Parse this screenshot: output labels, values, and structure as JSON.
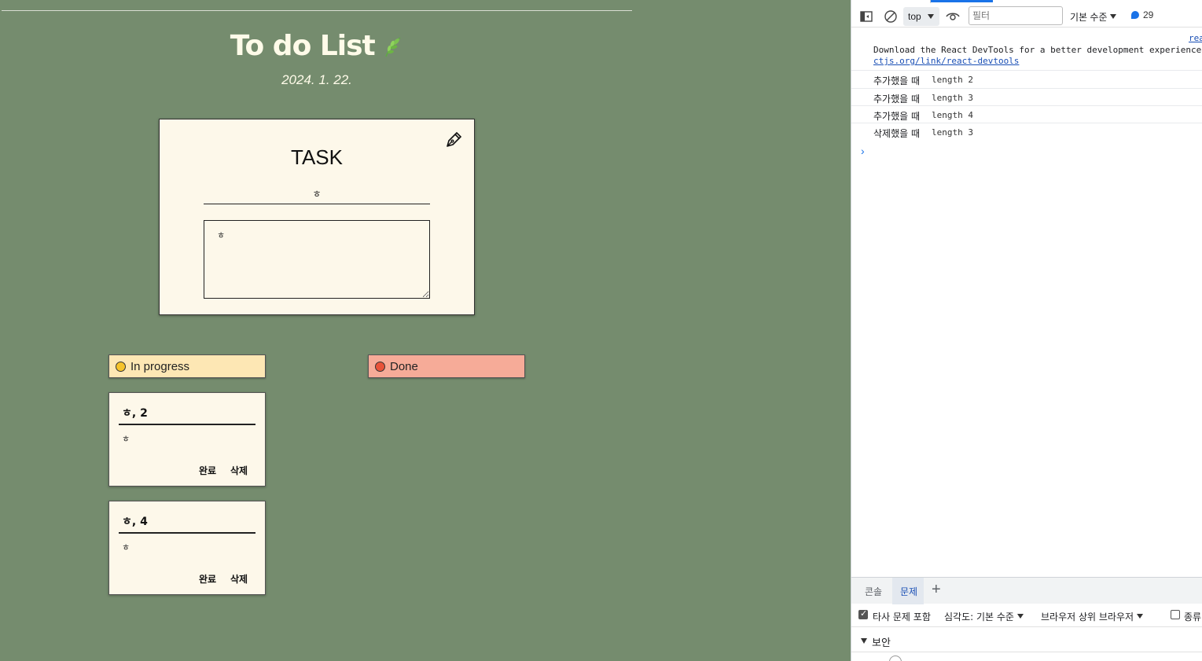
{
  "app": {
    "title": "To do List",
    "date": "2024. 1. 22.",
    "task_form": {
      "heading": "TASK",
      "title_value": "ㅎ",
      "content_value": "ㅎ"
    },
    "status": {
      "in_progress": "In progress",
      "done": "Done"
    },
    "todos": [
      {
        "title": "ㅎ, 2",
        "body": "ㅎ",
        "complete_label": "완료",
        "delete_label": "삭제"
      },
      {
        "title": "ㅎ, 4",
        "body": "ㅎ",
        "complete_label": "완료",
        "delete_label": "삭제"
      }
    ],
    "colors": {
      "background": "#758c6e",
      "card": "#fdf8ea",
      "in_progress": "#fde7b4",
      "done": "#f6ab98"
    }
  },
  "devtools": {
    "toolbar": {
      "context": "top",
      "filter_placeholder": "필터",
      "level": "기본 수준",
      "issues": "29"
    },
    "console": {
      "top_link": "rea",
      "devtools_message": "Download the React DevTools for a better development experience",
      "devtools_link": "ctjs.org/link/react-devtools",
      "logs": [
        {
          "label": "추가했을 때",
          "value": "length 2"
        },
        {
          "label": "추가했을 때",
          "value": "length 3"
        },
        {
          "label": "추가했을 때",
          "value": "length 4"
        },
        {
          "label": "삭제했을 때",
          "value": "length 3"
        }
      ],
      "prompt": "›"
    },
    "drawer": {
      "tab_console": "콘솔",
      "tab_issues": "문제",
      "add": "+"
    },
    "issues_bar": {
      "third_party": "타사 문제 포함",
      "severity": "심각도: 기본 수준",
      "browser": "브라우저 상위 브라우저",
      "cut_label": "종류"
    },
    "section": "보안"
  }
}
